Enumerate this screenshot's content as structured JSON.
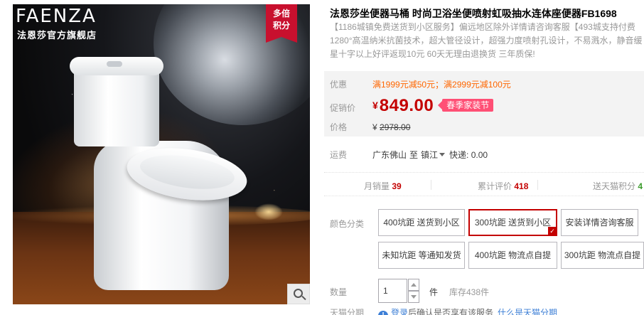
{
  "gallery": {
    "brand_logo": "FAENZA",
    "brand_store": "法恩莎官方旗舰店",
    "badge_line1": "多倍",
    "badge_line2": "积分",
    "zoom_icon": "magnifier-icon"
  },
  "product": {
    "title": "法恩莎坐便器马桶 时尚卫浴坐便喷射虹吸抽水连体座便器FB1698",
    "subtitle": "【1186城镇免费送货到小区服务】偏远地区除外详情请咨询客服【493城支持付费1280°高温纳米抗菌技术，超大管径设计，超强力度喷射孔设计，不易溅水，静音缓星十字以上好评返现10元 60天无理由退换货 三年质保!"
  },
  "pricing": {
    "promo_label": "优惠",
    "promo_text": "满1999元减50元；满2999元减100元",
    "price_label": "促销价",
    "currency": "¥",
    "price": "849.00",
    "sale_tag": "春季家装节",
    "orig_label": "价格",
    "orig_currency": "¥",
    "orig_price": "2978.00"
  },
  "shipping": {
    "label": "运费",
    "from": "广东佛山",
    "to_prefix": "至",
    "to": "镇江",
    "fee": "快递: 0.00"
  },
  "stats": {
    "sales_label": "月销量",
    "sales_value": "39",
    "reviews_label": "累计评价",
    "reviews_value": "418",
    "points_label": "送天猫积分",
    "points_value": "4"
  },
  "sku": {
    "label": "颜色分类",
    "options": [
      {
        "label": "400坑距 送货到小区",
        "selected": false
      },
      {
        "label": "300坑距 送货到小区",
        "selected": true
      },
      {
        "label": "安装详情咨询客服",
        "selected": false
      },
      {
        "label": "未知坑距 等通知发货",
        "selected": false
      },
      {
        "label": "400坑距 物流点自提",
        "selected": false
      },
      {
        "label": "300坑距 物流点自提",
        "selected": false
      }
    ]
  },
  "quantity": {
    "label": "数量",
    "value": "1",
    "unit": "件",
    "stock": "库存438件"
  },
  "installment": {
    "label": "天猫分期",
    "icon": "info-icon",
    "login": "登录",
    "text": "后确认是否享有该服务",
    "link": "什么是天猫分期"
  }
}
